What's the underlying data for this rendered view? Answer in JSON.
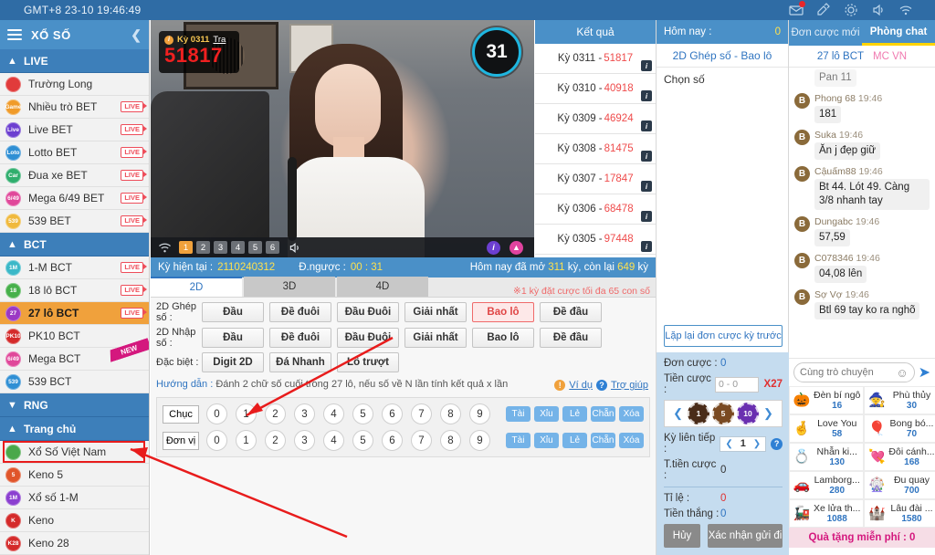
{
  "topbar": {
    "clock": "GMT+8 23-10 19:46:49",
    "icons": [
      "mail-icon",
      "ticket-icon",
      "gear-icon",
      "volume-icon",
      "wifi-icon"
    ]
  },
  "sidebar": {
    "title": "XỔ SỐ",
    "collapse_icon": "chevron-left-icon",
    "groups": [
      {
        "label": "LIVE",
        "arrow": "chevron-up-icon",
        "items": [
          {
            "label": "Trường Long",
            "icon": "chart-icon",
            "color": "#e13b3b",
            "short": "",
            "live": false
          },
          {
            "label": "Nhiều trò BET",
            "icon": "game-icon",
            "color": "#f09b2a",
            "short": "Game",
            "live": true
          },
          {
            "label": "Live BET",
            "icon": "live-icon",
            "color": "#6c3fd0",
            "short": "Live",
            "live": true
          },
          {
            "label": "Lotto BET",
            "icon": "lotto-icon",
            "color": "#2f8fd4",
            "short": "Loto",
            "live": true
          },
          {
            "label": "Đua xe BET",
            "icon": "car-icon",
            "color": "#2fae6d",
            "short": "Car",
            "live": true
          },
          {
            "label": "Mega 6/49 BET",
            "icon": "mega-icon",
            "color": "#e0489a",
            "short": "6/49",
            "live": true
          },
          {
            "label": "539 BET",
            "icon": "539-icon",
            "color": "#f0b93c",
            "short": "539",
            "live": true
          }
        ]
      },
      {
        "label": "BCT",
        "arrow": "chevron-up-icon",
        "items": [
          {
            "label": "1-M BCT",
            "icon": "1m-icon",
            "color": "#3bb8c8",
            "short": "1M",
            "live": true
          },
          {
            "label": "18 lô BCT",
            "icon": "18-icon",
            "color": "#46b04a",
            "short": "18",
            "live": true
          },
          {
            "label": "27 lô BCT",
            "icon": "27-icon",
            "color": "#9b39c4",
            "short": "27",
            "live": true,
            "selected": true
          },
          {
            "label": "PK10 BCT",
            "icon": "pk10-icon",
            "color": "#d42a2a",
            "short": "PK10",
            "live": false
          },
          {
            "label": "Mega BCT",
            "icon": "mega-icon",
            "color": "#e0489a",
            "short": "6/49",
            "live": false,
            "ribbon": "NEW"
          },
          {
            "label": "539 BCT",
            "icon": "539-icon",
            "color": "#2f8fd4",
            "short": "539",
            "live": false
          }
        ]
      },
      {
        "label": "RNG",
        "arrow": "chevron-down-icon",
        "items": []
      },
      {
        "label": "Trang chủ",
        "arrow": "chevron-up-icon",
        "items": [
          {
            "label": "Xổ Số Việt Nam",
            "icon": "balls-icon",
            "color": "#4aa84a",
            "short": "",
            "live": false,
            "highlighted": true
          },
          {
            "label": "Keno 5",
            "icon": "keno5-icon",
            "color": "#e0552a",
            "short": "5",
            "live": false
          },
          {
            "label": "Xổ số 1-M",
            "icon": "flag-icon",
            "color": "#8b3fd0",
            "short": "1M",
            "live": false
          },
          {
            "label": "Keno",
            "icon": "keno-icon",
            "color": "#d42a2a",
            "short": "K",
            "live": false
          },
          {
            "label": "Keno 28",
            "icon": "keno28-icon",
            "color": "#d42a2a",
            "short": "K28",
            "live": false
          }
        ]
      }
    ]
  },
  "video": {
    "result_badge": {
      "ky": "Kỳ 0311",
      "tra": "Tra",
      "number": "51817",
      "info_icon": "info-icon"
    },
    "countdown": "31",
    "quality_levels": [
      "1",
      "2",
      "3",
      "4",
      "5",
      "6"
    ],
    "quality_active": "1",
    "wifi_icon": "wifi-icon",
    "volume_icon": "volume-icon",
    "info_icon": "info-icon",
    "stats_icon": "stats-icon"
  },
  "results": {
    "header": "Kết quả",
    "info_icon": "info-icon",
    "rows": [
      {
        "ky": "Kỳ 0311",
        "num": "51817"
      },
      {
        "ky": "Kỳ 0310",
        "num": "40918"
      },
      {
        "ky": "Kỳ 0309",
        "num": "46924"
      },
      {
        "ky": "Kỳ 0308",
        "num": "81475"
      },
      {
        "ky": "Kỳ 0307",
        "num": "17847"
      },
      {
        "ky": "Kỳ 0306",
        "num": "68478"
      },
      {
        "ky": "Kỳ 0305",
        "num": "97448"
      }
    ]
  },
  "status": {
    "ky_label": "Kỳ hiện tại :",
    "ky_value": "2110240312",
    "countdown_label": "Đ.ngược :",
    "countdown_value": "00 : 31",
    "today_prefix": "Hôm nay đã mở",
    "today_opened": "311",
    "today_mid": "kỳ, còn lại",
    "today_left": "649",
    "today_suffix": "kỳ"
  },
  "today": {
    "header_label": "Hôm nay :",
    "header_value": "0",
    "subtitle": "2D Ghép số - Bao lô",
    "pick_label": "Chọn số"
  },
  "betslip": {
    "repeat_label": "Lặp lại đơn cược kỳ trước",
    "order_label": "Đơn cược :",
    "order_value": "0",
    "money_label": "Tiền cược :",
    "money_placeholder": "0 - 0",
    "multiplier": "X27",
    "chips": [
      "1",
      "5",
      "10"
    ],
    "chip_prev_icon": "chevron-left-icon",
    "chip_next_icon": "chevron-right-icon",
    "consecutive_label": "Kỳ liên tiếp :",
    "consecutive_value": "1",
    "help_icon": "question-icon",
    "total_label": "T.tiền cược :",
    "total_value": "0",
    "rate_label": "Tỉ     lệ :",
    "rate_value": "0",
    "win_label": "Tiền thắng :",
    "win_value": "0",
    "cancel_label": "Hủy",
    "confirm_label": "Xác nhận gửi đi"
  },
  "betpanel": {
    "tabs": [
      {
        "label": "2D",
        "active": true
      },
      {
        "label": "3D",
        "active": false
      },
      {
        "label": "4D",
        "active": false
      }
    ],
    "note": "※1 kỳ đặt cược tối đa 65 con số",
    "rows": [
      {
        "label": "2D Ghép số :",
        "buttons": [
          {
            "label": "Đầu",
            "selected": false
          },
          {
            "label": "Đề đuôi",
            "selected": false
          },
          {
            "label": "Đầu Đuôi",
            "selected": false
          },
          {
            "label": "Giải nhất",
            "selected": false
          },
          {
            "label": "Bao lô",
            "selected": true
          },
          {
            "label": "Đề đầu",
            "selected": false
          }
        ]
      },
      {
        "label": "2D Nhập số :",
        "buttons": [
          {
            "label": "Đầu",
            "selected": false
          },
          {
            "label": "Đề đuôi",
            "selected": false
          },
          {
            "label": "Đầu Đuôi",
            "selected": false
          },
          {
            "label": "Giải nhất",
            "selected": false
          },
          {
            "label": "Bao lô",
            "selected": false
          },
          {
            "label": "Đề đầu",
            "selected": false
          }
        ]
      },
      {
        "label": "Đặc biệt :",
        "buttons": [
          {
            "label": "Digit 2D",
            "selected": false
          },
          {
            "label": "Đá Nhanh",
            "selected": false
          },
          {
            "label": "Lô trượt",
            "selected": false
          }
        ]
      }
    ],
    "hint_label": "Hướng dẫn :",
    "hint_text": "Đánh 2 chữ số cuối trong 27 lô, nếu số về N lần tính kết quả x lần",
    "example_link": "Ví dụ",
    "help_link": "Trợ giúp",
    "warn_icon": "warning-icon",
    "question_icon": "question-icon",
    "numpad": {
      "rows": [
        {
          "label": "Chục",
          "digits": [
            "0",
            "1",
            "2",
            "3",
            "4",
            "5",
            "6",
            "7",
            "8",
            "9"
          ]
        },
        {
          "label": "Đơn vị",
          "digits": [
            "0",
            "1",
            "2",
            "3",
            "4",
            "5",
            "6",
            "7",
            "8",
            "9"
          ]
        }
      ],
      "actions": [
        "Tài",
        "Xỉu",
        "Lẻ",
        "Chẵn",
        "Xóa"
      ]
    }
  },
  "chat": {
    "tabs": [
      {
        "label": "Đơn cược mới",
        "active": false
      },
      {
        "label": "Phòng chat",
        "active": true
      }
    ],
    "rooms": [
      {
        "label": "27 lô BCT",
        "color": "#2f74c0"
      },
      {
        "label": "MC VN",
        "color": "#f07ab0"
      }
    ],
    "messages": [
      {
        "clipped": true,
        "name": "",
        "time": "",
        "text": "Pan 11"
      },
      {
        "name": "Phong 68",
        "time": "19:46",
        "text": "181"
      },
      {
        "name": "Suka",
        "time": "19:46",
        "text": "Ăn j đẹp giữ"
      },
      {
        "name": "Cậuấm88",
        "time": "19:46",
        "text": "Bt 44. Lót 49. Càng 3/8 nhanh tay"
      },
      {
        "name": "Dungabc",
        "time": "19:46",
        "text": "57,59"
      },
      {
        "name": "C078346",
        "time": "19:46",
        "text": "04,08 lên"
      },
      {
        "name": "Sợ Vợ",
        "time": "19:46",
        "text": "Btl 69 tay ko ra nghõ"
      }
    ],
    "input_placeholder": "Cùng trò chuyện",
    "smile_icon": "smiley-icon",
    "send_icon": "send-icon",
    "gifts": [
      {
        "name": "Đèn bí ngô",
        "value": "16",
        "glyph": "🎃"
      },
      {
        "name": "Phù thủy",
        "value": "30",
        "glyph": "🧙"
      },
      {
        "name": "Love You",
        "value": "58",
        "glyph": "🤞"
      },
      {
        "name": "Bong bó...",
        "value": "70",
        "glyph": "🎈"
      },
      {
        "name": "Nhẫn ki...",
        "value": "130",
        "glyph": "💍"
      },
      {
        "name": "Đôi cánh...",
        "value": "168",
        "glyph": "💘"
      },
      {
        "name": "Lamborg...",
        "value": "280",
        "glyph": "🚗"
      },
      {
        "name": "Đu quay",
        "value": "700",
        "glyph": "🎡"
      },
      {
        "name": "Xe lửa th...",
        "value": "1088",
        "glyph": "🚂"
      },
      {
        "name": "Lâu đài ...",
        "value": "1580",
        "glyph": "🏰"
      }
    ],
    "free_gift_label": "Quà tặng miễn phí  : 0"
  }
}
